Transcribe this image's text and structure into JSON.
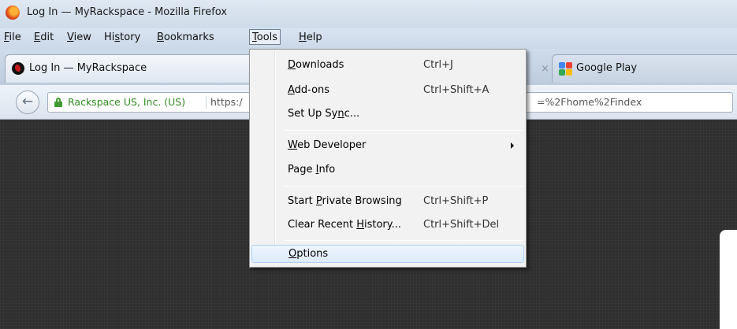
{
  "window": {
    "title": "Log In — MyRackspace - Mozilla Firefox"
  },
  "menubar": {
    "items": [
      "File",
      "Edit",
      "View",
      "History",
      "Bookmarks",
      "Tools",
      "Help"
    ]
  },
  "tabs": [
    {
      "label": "Log In — MyRackspace",
      "icon": "rackspace-icon",
      "active": true
    },
    {
      "label": "Google Play",
      "icon": "google-play-icon",
      "active": false
    }
  ],
  "navbar": {
    "site_identity": "Rackspace US, Inc. (US)",
    "url_left": "https:/",
    "url_right": "=%2Fhome%2Findex"
  },
  "tools_menu": {
    "items": [
      {
        "label": "Downloads",
        "underline": "D",
        "accel": "Ctrl+J"
      },
      {
        "label": "Add-ons",
        "underline": "A",
        "accel": "Ctrl+Shift+A"
      },
      {
        "label": "Set Up Sync...",
        "underline": "n",
        "accel": ""
      },
      {
        "label": "Web Developer",
        "underline": "W",
        "accel": "",
        "submenu": true
      },
      {
        "label": "Page Info",
        "underline": "I",
        "accel": ""
      },
      {
        "label": "Start Private Browsing",
        "underline": "P",
        "accel": "Ctrl+Shift+P"
      },
      {
        "label": "Clear Recent History...",
        "underline": "H",
        "accel": "Ctrl+Shift+Del"
      },
      {
        "label": "Options",
        "underline": "O",
        "accel": "",
        "highlighted": true
      }
    ]
  },
  "colors": {
    "secure_green": "#2f8b20",
    "menu_highlight": "#dcebfc",
    "page_background": "#2f2f2f"
  }
}
